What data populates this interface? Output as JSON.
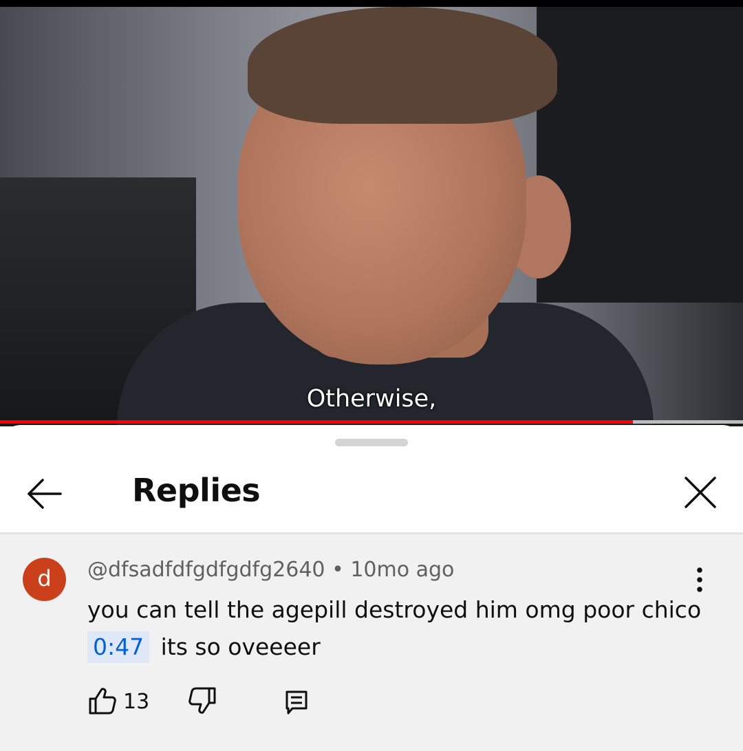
{
  "video": {
    "subtitle": "Otherwise,",
    "progress_fraction": 0.852
  },
  "header": {
    "title": "Replies",
    "back_icon": "arrow-left-icon",
    "close_icon": "close-icon"
  },
  "comment": {
    "avatar_letter": "d",
    "avatar_color": "#c9401b",
    "author": "@dfsadfdfgdfgdfg2640",
    "separator": "•",
    "time": "10mo ago",
    "text_line1": "you can tell the agepill destroyed him omg poor chico",
    "timestamp": "0:47",
    "text_after_timestamp": "its so oveeeer",
    "like_count": "13"
  },
  "colors": {
    "progress": "#ff0000",
    "timestamp_link": "#065fd4",
    "comment_bg": "#f1f1f1"
  }
}
